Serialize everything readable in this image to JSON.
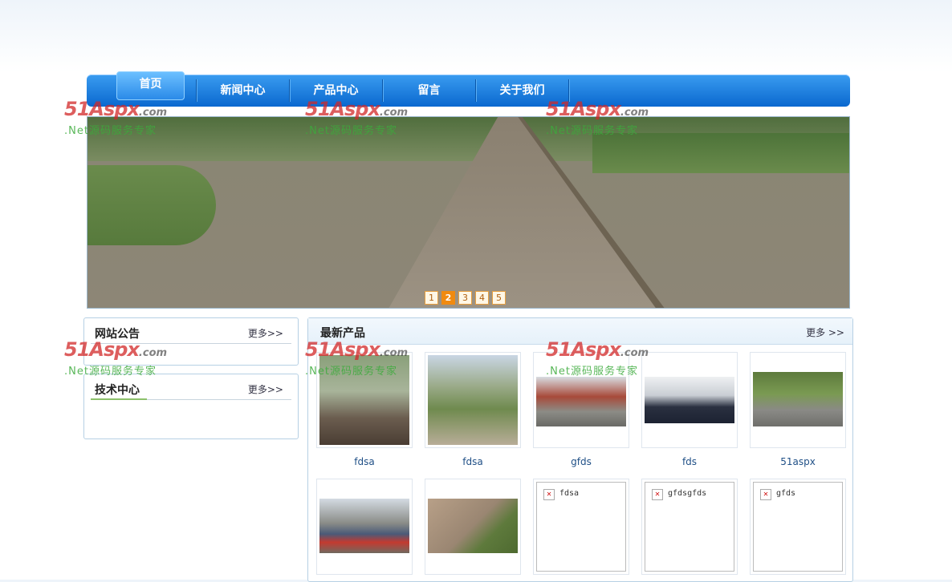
{
  "nav": {
    "items": [
      {
        "label": "首页",
        "active": true
      },
      {
        "label": "新闻中心"
      },
      {
        "label": "产品中心"
      },
      {
        "label": "留言"
      },
      {
        "label": "关于我们"
      }
    ]
  },
  "banner": {
    "pages": [
      "1",
      "2",
      "3",
      "4",
      "5"
    ],
    "current_page": 2
  },
  "announcements": {
    "title": "网站公告",
    "more": "更多>>"
  },
  "tech": {
    "title": "技术中心",
    "more": "更多>>"
  },
  "products": {
    "title": "最新产品",
    "more": "更多 >>",
    "items": [
      {
        "name": "fdsa"
      },
      {
        "name": "fdsa"
      },
      {
        "name": "gfds"
      },
      {
        "name": "fds"
      },
      {
        "name": "51aspx"
      },
      {
        "name": ""
      },
      {
        "name": ""
      },
      {
        "broken_alt": "fdsa"
      },
      {
        "broken_alt": "gfdsgfds"
      },
      {
        "broken_alt": "gfds"
      }
    ]
  },
  "watermark": {
    "logo": "51Aspx",
    "logo_suffix": ".com",
    "tagline": ".Net源码服务专家"
  },
  "colors": {
    "nav_top": "#3a9cf0",
    "nav_bottom": "#0a68cf",
    "accent_orange": "#f08a10",
    "caption_blue": "#1f4f86"
  }
}
